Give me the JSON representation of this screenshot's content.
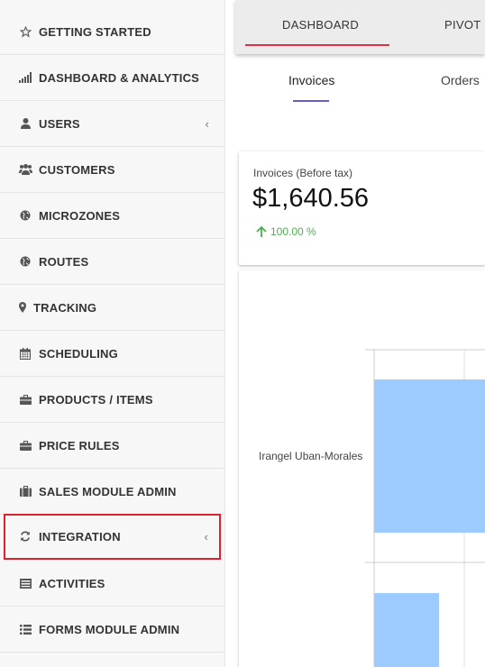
{
  "sidebar": {
    "items": [
      {
        "label": "GETTING STARTED",
        "icon": "star-outline-icon"
      },
      {
        "label": "DASHBOARD & ANALYTICS",
        "icon": "bar-chart-icon"
      },
      {
        "label": "USERS",
        "icon": "user-icon",
        "chevron": "‹"
      },
      {
        "label": "CUSTOMERS",
        "icon": "users-group-icon"
      },
      {
        "label": "MICROZONES",
        "icon": "globe-icon"
      },
      {
        "label": "ROUTES",
        "icon": "globe-icon"
      },
      {
        "label": "TRACKING",
        "icon": "map-marker-icon"
      },
      {
        "label": "SCHEDULING",
        "icon": "calendar-icon"
      },
      {
        "label": "PRODUCTS / ITEMS",
        "icon": "briefcase-icon"
      },
      {
        "label": "PRICE RULES",
        "icon": "briefcase-icon"
      },
      {
        "label": "SALES MODULE ADMIN",
        "icon": "suitcase-icon"
      },
      {
        "label": "INTEGRATION",
        "icon": "refresh-icon",
        "chevron": "‹",
        "selected": true
      },
      {
        "label": "ACTIVITIES",
        "icon": "list-alt-icon"
      },
      {
        "label": "FORMS MODULE ADMIN",
        "icon": "list-icon"
      }
    ]
  },
  "top_tabs": [
    {
      "label": "DASHBOARD",
      "active": true
    },
    {
      "label": "PIVOT",
      "active": false
    }
  ],
  "sub_tabs": [
    {
      "label": "Invoices",
      "active": true
    },
    {
      "label": "Orders",
      "active": false
    }
  ],
  "kpi": {
    "title": "Invoices (Before tax)",
    "value": "$1,640.56",
    "change": "100.00 %",
    "change_color": "#4caf50"
  },
  "colors": {
    "accent_red": "#e2324a",
    "accent_purple": "#6a5acd",
    "bar_fill": "#9ecbff"
  },
  "chart_data": {
    "type": "bar",
    "orientation": "horizontal",
    "categories": [
      "Irangel Uban-Morales",
      ""
    ],
    "visible_category_label": "Irangel Uban-Morales"
  }
}
